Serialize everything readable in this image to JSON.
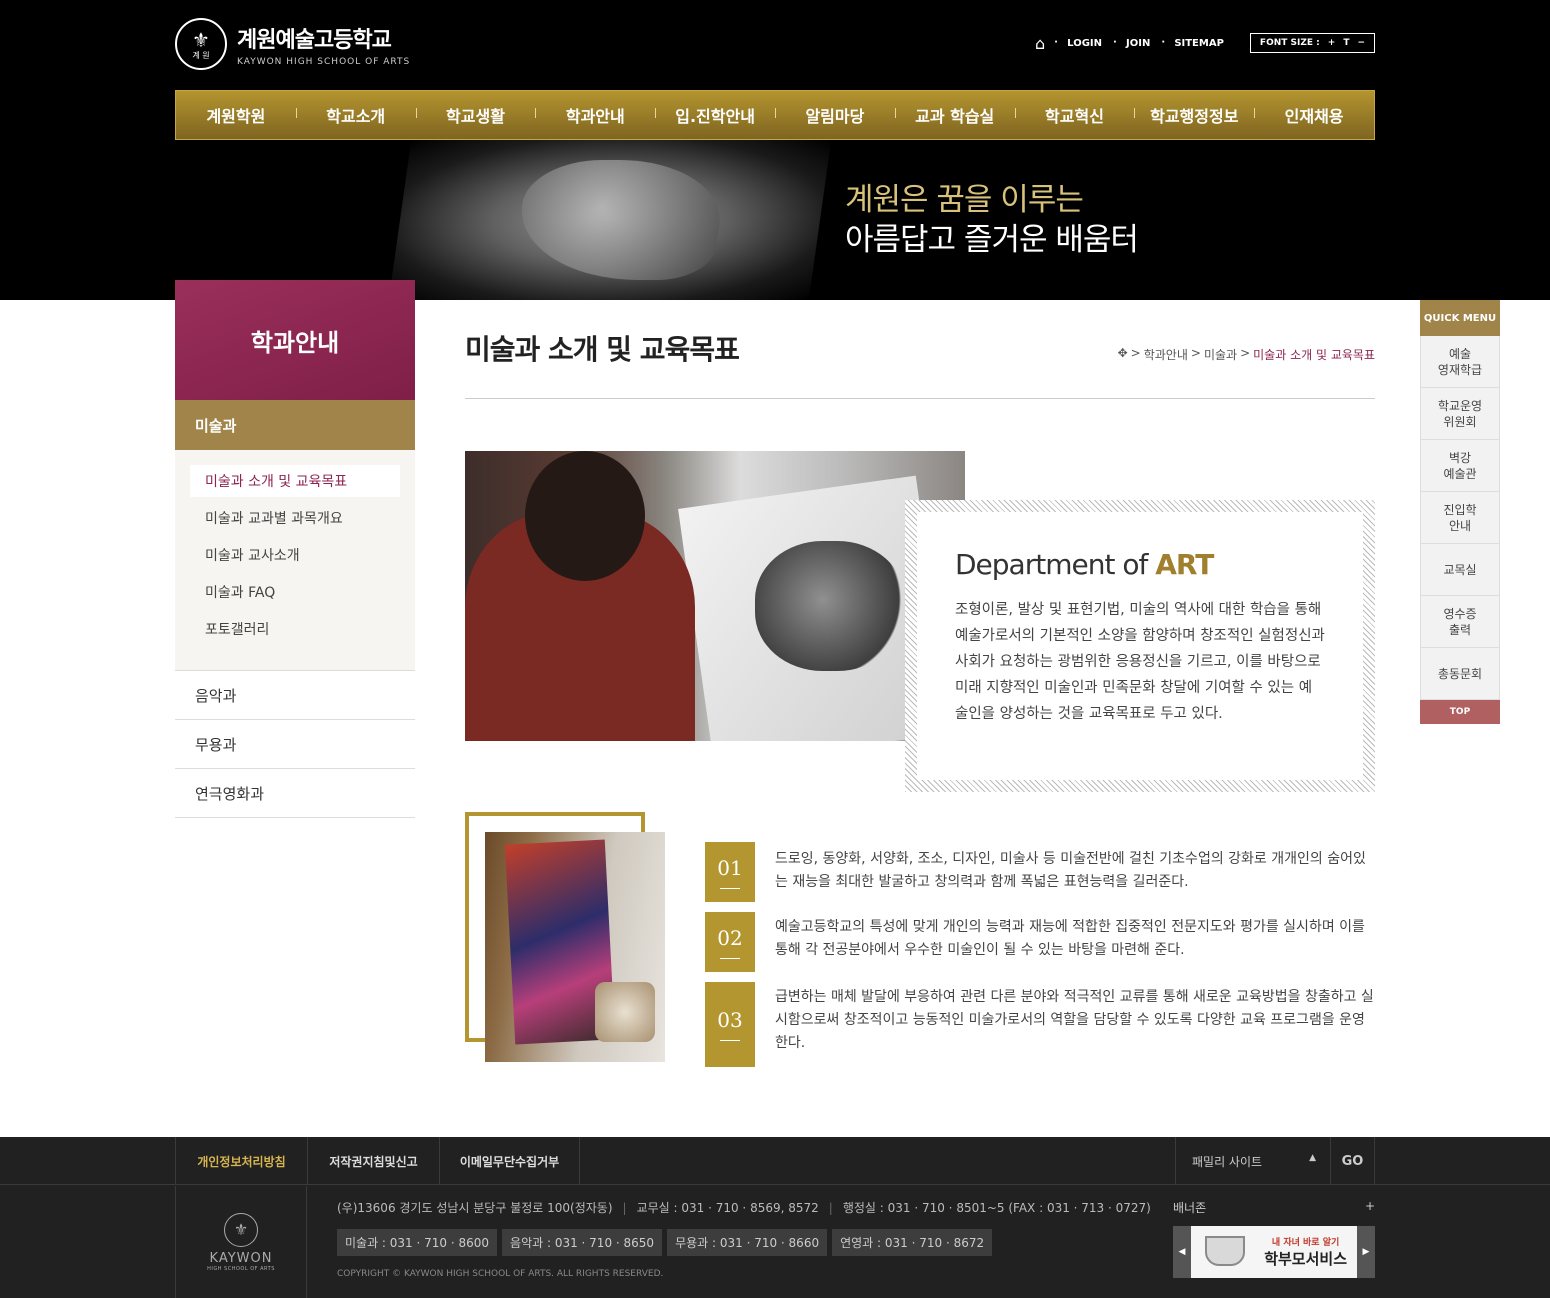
{
  "site": {
    "logo_kor": "계원예술고등학교",
    "logo_eng": "KAYWON HIGH SCHOOL OF ARTS",
    "emblem_text": "계 원",
    "util_links": [
      "LOGIN",
      "JOIN",
      "SITEMAP"
    ],
    "font_size_label": "FONT SIZE :",
    "font_size_plus": "+",
    "font_size_reset": "T",
    "font_size_minus": "−"
  },
  "gnb": [
    "계원학원",
    "학교소개",
    "학교생활",
    "학과안내",
    "입.진학안내",
    "알림마당",
    "교과 학습실",
    "학교혁신",
    "학교행정정보",
    "인재채용"
  ],
  "hero": {
    "line1": "계원은 꿈을 이루는",
    "line2": "아름답고 즐거운 배움터"
  },
  "lnb": {
    "title": "학과안내",
    "active": "미술과",
    "sub_items": [
      "미술과 소개 및 교육목표",
      "미술과 교과별 과목개요",
      "미술과 교사소개",
      "미술과 FAQ",
      "포토갤러리"
    ],
    "depts": [
      "음악과",
      "무용과",
      "연극영화과"
    ]
  },
  "content": {
    "page_title": "미술과 소개 및 교육목표",
    "breadcrumb": [
      "학과안내",
      "미술과",
      "미술과 소개 및 교육목표"
    ],
    "dept_title": "Department of",
    "dept_title_accent": "ART",
    "dept_desc": "조형이론, 발상 및 표현기법, 미술의 역사에 대한 학습을 통해 예술가로서의 기본적인 소양을 함양하며 창조적인 실험정신과 사회가 요청하는 광범위한 응용정신을 기르고, 이를 바탕으로 미래 지향적인 미술인과 민족문화 창달에 기여할 수 있는 예술인을 양성하는 것을 교육목표로 두고 있다.",
    "goals": [
      {
        "num": "01",
        "text": "드로잉, 동양화, 서양화, 조소, 디자인, 미술사 등 미술전반에 걸친 기초수업의 강화로 개개인의 숨어있는 재능을 최대한 발굴하고 창의력과 함께 폭넓은 표현능력을 길러준다."
      },
      {
        "num": "02",
        "text": "예술고등학교의 특성에 맞게 개인의 능력과 재능에 적합한 집중적인 전문지도와 평가를 실시하며 이를 통해 각 전공분야에서 우수한 미술인이 될 수 있는 바탕을 마련해 준다."
      },
      {
        "num": "03",
        "text": "급변하는 매체 발달에 부응하여 관련 다른 분야와 적극적인 교류를 통해 새로운 교육방법을 창출하고 실시함으로써 창조적이고 능동적인 미술가로서의 역할을 담당할 수 있도록 다양한 교육 프로그램을 운영한다."
      }
    ]
  },
  "quick": {
    "head": "QUICK MENU",
    "items": [
      "예술\n영재학급",
      "학교운영\n위원회",
      "벽강\n예술관",
      "진입학\n안내",
      "교목실",
      "영수증\n출력",
      "총동문회"
    ],
    "top": "TOP"
  },
  "footer": {
    "links": [
      "개인정보처리방침",
      "저작권지침및신고",
      "이메일무단수집거부"
    ],
    "family_label": "패밀리 사이트",
    "go_label": "GO",
    "logo_name": "KAYWON",
    "logo_sub": "HIGH SCHOOL OF ARTS",
    "address": [
      "(우)13606 경기도 성남시 분당구 불정로 100(정자동)",
      "교무실 : 031 · 710 · 8569, 8572",
      "행정실 : 031 · 710 · 8501~5 (FAX : 031 · 713 · 0727)"
    ],
    "phones": [
      "미술과 : 031 · 710 · 8600",
      "음악과 : 031 · 710 · 8650",
      "무용과 : 031 · 710 · 8660",
      "연영과 : 031 · 710 · 8672"
    ],
    "copyright": "COPYRIGHT © KAYWON HIGH SCHOOL OF ARTS. ALL RIGHTS RESERVED.",
    "banner_label": "배너존",
    "banner_plus": "+",
    "banner_t1": "내 자녀 바로 알기",
    "banner_t2": "학부모서비스"
  }
}
